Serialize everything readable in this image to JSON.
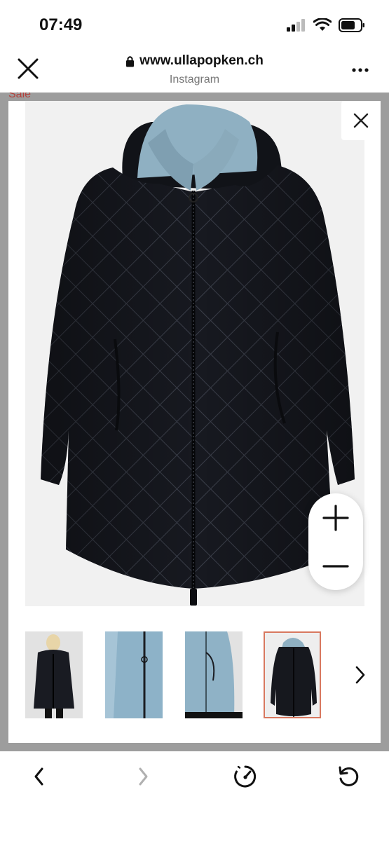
{
  "status_bar": {
    "time": "07:49"
  },
  "browser": {
    "url": "www.ullapopken.ch",
    "source": "Instagram"
  },
  "page": {
    "sale_label": "Sale"
  },
  "colors": {
    "jacket": "#14161c",
    "lining": "#8fb0c2",
    "accent_border": "#d8785f",
    "sale": "#b3403b"
  },
  "gallery": {
    "thumbnail_count": 4,
    "selected_index": 3
  }
}
